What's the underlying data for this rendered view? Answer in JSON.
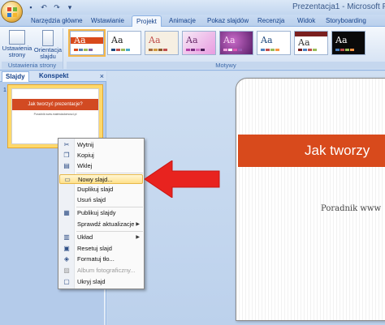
{
  "window": {
    "title": "Prezentacja1 - Microsoft Pow"
  },
  "qat": {
    "save_icon": "save-icon",
    "undo_icon": "undo-icon",
    "redo_icon": "redo-icon",
    "customize_icon": "qat-dropdown-icon"
  },
  "tabs": [
    {
      "label": "Narzędzia główne"
    },
    {
      "label": "Wstawianie"
    },
    {
      "label": "Projekt"
    },
    {
      "label": "Animacje"
    },
    {
      "label": "Pokaz slajdów"
    },
    {
      "label": "Recenzja"
    },
    {
      "label": "Widok"
    },
    {
      "label": "Storyboarding"
    }
  ],
  "ribbon": {
    "page_group": {
      "setup_label": "Ustawienia strony",
      "orientation_label": "Orientacja slajdu",
      "group_label": "Ustawienia strony"
    },
    "themes_group": {
      "group_label": "Motywy",
      "theme_glyph": "Aa"
    }
  },
  "left_pane": {
    "tab_slides": "Slajdy",
    "tab_outline": "Konspekt",
    "close_glyph": "×",
    "slide_number": "1",
    "thumb_title": "Jak tworzyć prezentacje?",
    "thumb_subtitle": "Poradnik www.malewiadomosci.pl"
  },
  "slide": {
    "title": "Jak tworzy",
    "subtitle": "Poradnik www"
  },
  "context_menu": {
    "items": [
      {
        "label": "Wytnij",
        "icon": "scissors-icon"
      },
      {
        "label": "Kopiuj",
        "icon": "copy-icon"
      },
      {
        "label": "Wklej",
        "icon": "paste-icon"
      },
      {
        "label": "Nowy slajd...",
        "icon": "new-slide-icon",
        "highlighted": true
      },
      {
        "label": "Duplikuj slajd",
        "icon": "duplicate-icon"
      },
      {
        "label": "Usuń slajd",
        "icon": "delete-slide-icon"
      },
      {
        "label": "Publikuj slajdy",
        "icon": "publish-icon"
      },
      {
        "label": "Sprawdź aktualizacje",
        "icon": "",
        "submenu": true
      },
      {
        "label": "Układ",
        "icon": "layout-icon",
        "submenu": true
      },
      {
        "label": "Resetuj slajd",
        "icon": "reset-icon"
      },
      {
        "label": "Formatuj tło...",
        "icon": "format-background-icon"
      },
      {
        "label": "Album fotograficzny...",
        "icon": "photo-album-icon",
        "disabled": true
      },
      {
        "label": "Ukryj slajd",
        "icon": "hide-slide-icon"
      }
    ],
    "submenu_glyph": "▶"
  },
  "colors": {
    "accent_orange": "#d84a1c",
    "highlight": "#ffe08a",
    "arrow_red": "#e8231f"
  }
}
